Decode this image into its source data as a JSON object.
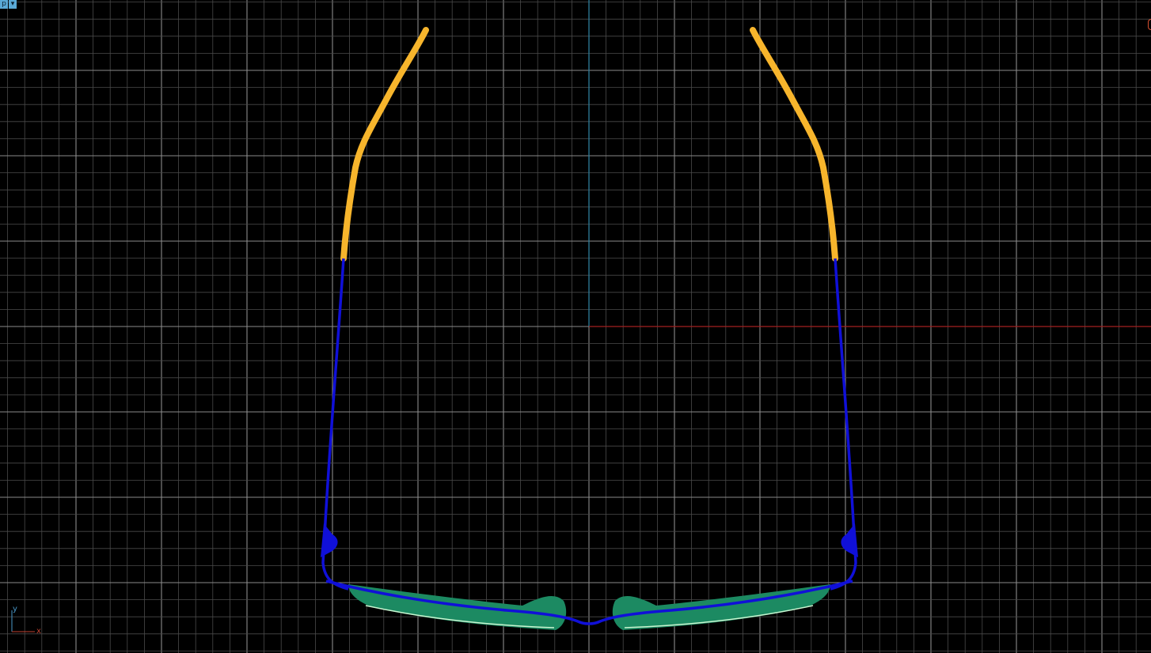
{
  "viewport": {
    "menu": {
      "view_label": "p",
      "dropdown_icon": "chevron-down-icon"
    },
    "axis_tripod": {
      "y_label": "y",
      "x_label": "x"
    },
    "colors": {
      "background": "#000000",
      "grid_minor": "#4a4a4a",
      "grid_major": "#8a8a8a",
      "world_y_axis": "#2a7f9f",
      "world_x_axis": "#a32020",
      "temple_tips": "#f7b52c",
      "frame_wire": "#1010d8",
      "lens": "#1c8a62",
      "lens_highlight": "#c8f5d0",
      "tripod": "#4a98c8",
      "tripod_x": "#c04030"
    }
  },
  "scene": {
    "object": "eyeglasses",
    "parts": [
      "left-temple-tip",
      "right-temple-tip",
      "left-temple",
      "right-temple",
      "frame-front",
      "left-lens",
      "right-lens",
      "nose-bridge"
    ]
  }
}
